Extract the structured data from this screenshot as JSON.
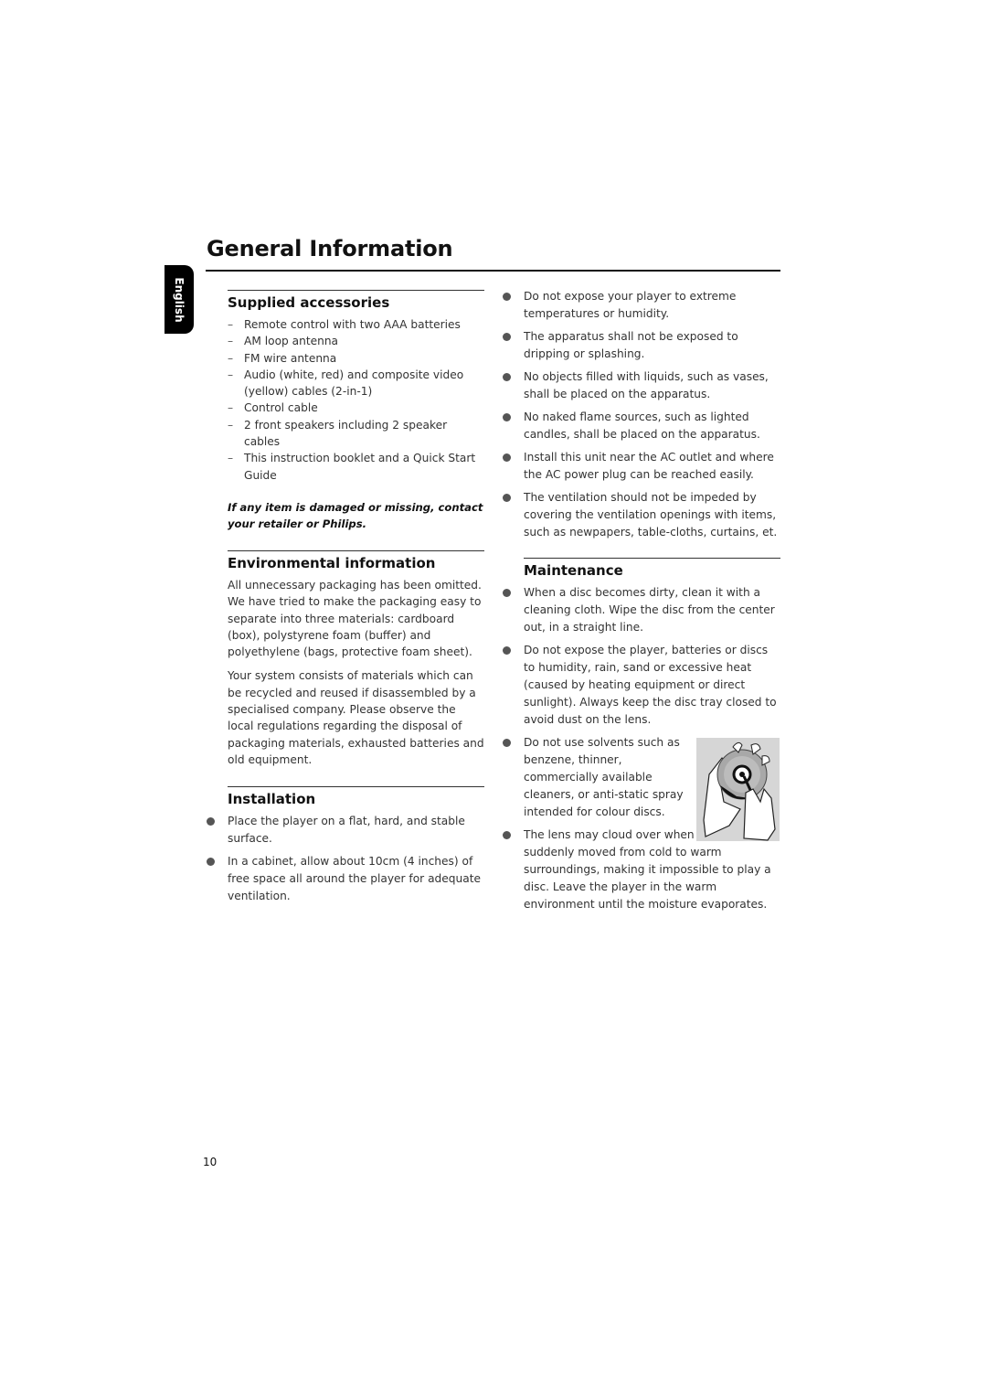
{
  "page_title": "General Information",
  "language_tab": "English",
  "page_number": "10",
  "supplied_accessories": {
    "heading": "Supplied accessories",
    "items": [
      "Remote control with two AAA batteries",
      "AM loop antenna",
      "FM wire antenna",
      "Audio (white, red) and composite video (yellow) cables (2-in-1)",
      "Control cable",
      "2 front speakers including 2 speaker cables",
      "This instruction booklet and a Quick Start Guide"
    ],
    "note": "If any item is damaged or missing, contact your retailer or Philips."
  },
  "environmental": {
    "heading": "Environmental information",
    "paragraphs": [
      "All unnecessary packaging has been omitted. We have tried to make the packaging easy to separate into three materials: cardboard (box), polystyrene foam (buffer) and polyethylene (bags, protective foam sheet).",
      "Your system consists of materials which can be recycled and reused if disassembled by a specialised company. Please observe the local regulations regarding the disposal of packaging materials, exhausted batteries and old equipment."
    ]
  },
  "installation": {
    "heading": "Installation",
    "items": [
      "Place the player on a flat, hard, and stable surface.",
      "In a cabinet, allow about 10cm (4 inches) of free space all around the player for adequate ventilation."
    ]
  },
  "safety": {
    "items": [
      "Do not expose your player to extreme temperatures or humidity.",
      "The apparatus shall not be exposed to dripping or splashing.",
      "No objects  filled with liquids, such as vases, shall be placed on the apparatus.",
      "No naked flame sources, such as lighted candles, shall be placed on the apparatus.",
      "Install this unit near the AC outlet and where the AC power plug can be reached easily.",
      "The ventilation should not be impeded by covering the ventilation openings with items, such as newpapers, table-cloths, curtains, et."
    ]
  },
  "maintenance": {
    "heading": "Maintenance",
    "items": [
      "When a disc becomes dirty, clean it with a cleaning cloth. Wipe the disc from the center out, in a straight line.",
      "Do not expose the player, batteries or discs to humidity, rain, sand or excessive heat (caused by heating equipment or direct sunlight). Always keep the disc tray closed to avoid dust on the lens.",
      "Do not use solvents such as benzene, thinner, commercially available cleaners, or anti-static spray intended for colour discs.",
      "The lens may cloud over when the player is suddenly moved from cold to warm surroundings, making it impossible to play a disc. Leave the player in the warm environment until the moisture evaporates."
    ],
    "image": "disc-cleaning-illustration"
  }
}
